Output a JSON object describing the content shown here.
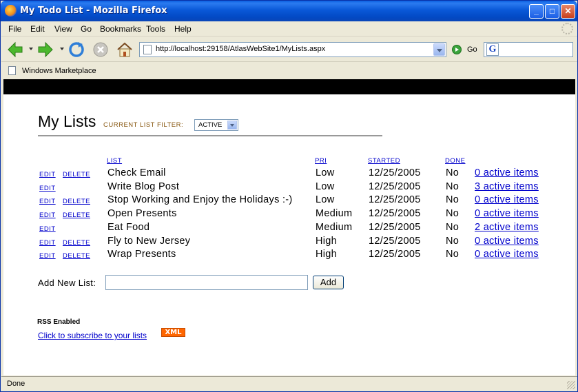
{
  "window": {
    "title": "My Todo List - Mozilla Firefox"
  },
  "menu": [
    "File",
    "Edit",
    "View",
    "Go",
    "Bookmarks",
    "Tools",
    "Help"
  ],
  "toolbar": {
    "url": "http://localhost:29158/AtlasWebSite1/MyLists.aspx",
    "go_label": "Go"
  },
  "bookmarks": [
    "Windows Marketplace"
  ],
  "page": {
    "heading": "My Lists",
    "filter_label": "CURRENT LIST FILTER:",
    "filter_value": "ACTIVE",
    "columns": {
      "list": "LIST",
      "pri": "PRI",
      "started": "STARTED",
      "done": "DONE"
    },
    "edit_label": "EDIT",
    "delete_label": "DELETE",
    "rows": [
      {
        "name": "Check Email",
        "pri": "Low",
        "started": "12/25/2005",
        "done": "No",
        "items": "0 active items",
        "deletable": true
      },
      {
        "name": "Write Blog Post",
        "pri": "Low",
        "started": "12/25/2005",
        "done": "No",
        "items": "3 active items",
        "deletable": false
      },
      {
        "name": "Stop Working and Enjoy the Holidays :-)",
        "pri": "Low",
        "started": "12/25/2005",
        "done": "No",
        "items": "0 active items",
        "deletable": true
      },
      {
        "name": "Open Presents",
        "pri": "Medium",
        "started": "12/25/2005",
        "done": "No",
        "items": "0 active items",
        "deletable": true
      },
      {
        "name": "Eat Food",
        "pri": "Medium",
        "started": "12/25/2005",
        "done": "No",
        "items": "2 active items",
        "deletable": false
      },
      {
        "name": "Fly to New Jersey",
        "pri": "High",
        "started": "12/25/2005",
        "done": "No",
        "items": "0 active items",
        "deletable": true
      },
      {
        "name": "Wrap Presents",
        "pri": "High",
        "started": "12/25/2005",
        "done": "No",
        "items": "0 active items",
        "deletable": true
      }
    ],
    "add_new_label": "Add New List:",
    "add_new_value": "",
    "add_button": "Add",
    "rss_label": "RSS Enabled",
    "rss_link": "Click to subscribe to your lists",
    "xml_badge": "XML"
  },
  "status": "Done"
}
